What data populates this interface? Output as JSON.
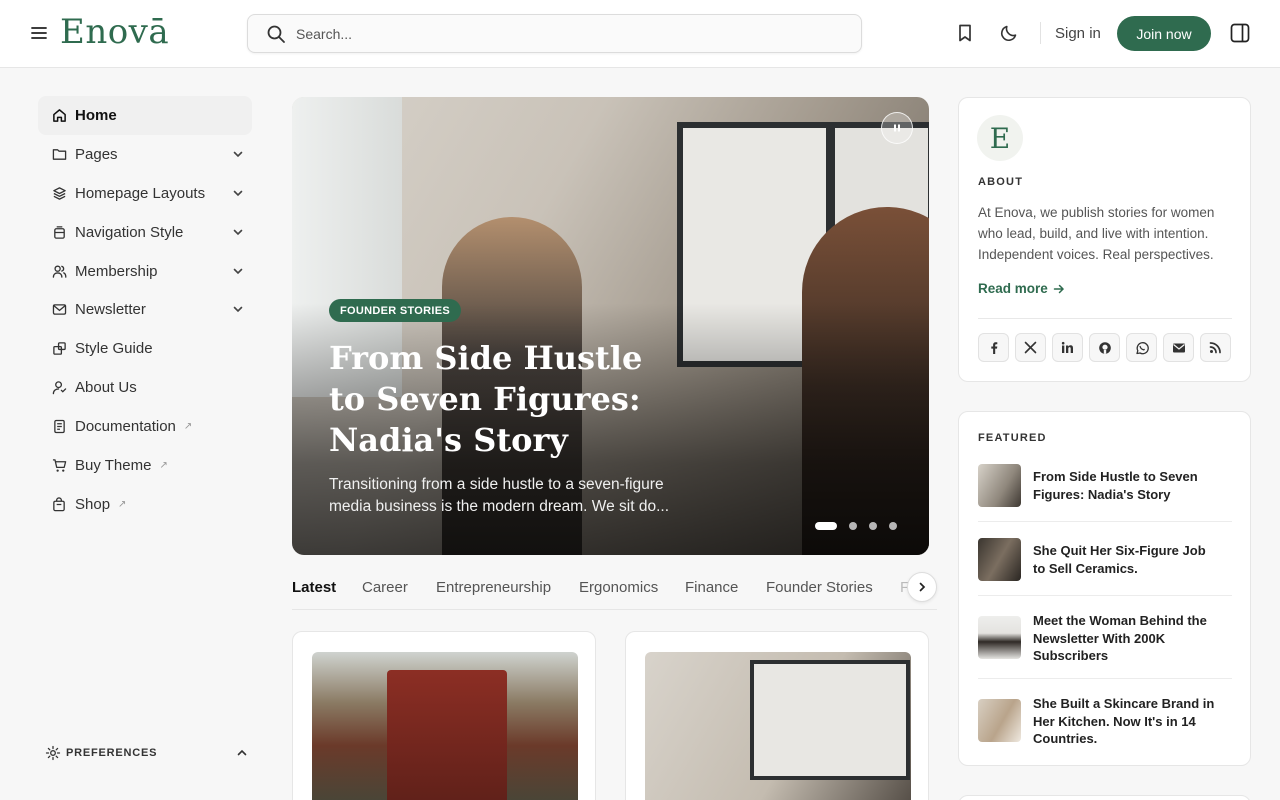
{
  "header": {
    "logo": "Enovā",
    "search_placeholder": "Search...",
    "sign_in": "Sign in",
    "join_now": "Join now",
    "accent": "#2f6b4f"
  },
  "sidebar": {
    "items": [
      {
        "label": "Home",
        "icon": "home-icon"
      },
      {
        "label": "Pages",
        "icon": "folder-icon"
      },
      {
        "label": "Homepage Layouts",
        "icon": "layers-icon"
      },
      {
        "label": "Navigation Style",
        "icon": "navigation-icon"
      },
      {
        "label": "Membership",
        "icon": "users-icon"
      },
      {
        "label": "Newsletter",
        "icon": "mail-icon"
      },
      {
        "label": "Style Guide",
        "icon": "style-icon"
      },
      {
        "label": "About Us",
        "icon": "user-icon"
      },
      {
        "label": "Documentation",
        "icon": "document-icon"
      },
      {
        "label": "Buy Theme",
        "icon": "cart-icon"
      },
      {
        "label": "Shop",
        "icon": "bag-icon"
      }
    ],
    "preferences": "PREFERENCES"
  },
  "hero": {
    "badge": "FOUNDER STORIES",
    "title": "From Side Hustle to Seven Figures: Nadia's Story",
    "excerpt": "Transitioning from a side hustle to a seven-figure media business is the modern dream. We sit do..."
  },
  "tabs": [
    "Latest",
    "Career",
    "Entrepreneurship",
    "Ergonomics",
    "Finance",
    "Founder Stories",
    "F"
  ],
  "about": {
    "emblem": "E",
    "label": "ABOUT",
    "text": "At Enova, we publish stories for women who lead, build, and live with intention. Independent voices. Real perspectives.",
    "read_more": "Read more"
  },
  "socials": [
    "facebook-icon",
    "x-icon",
    "linkedin-icon",
    "github-icon",
    "whatsapp-icon",
    "email-icon",
    "rss-icon"
  ],
  "featured": {
    "label": "FEATURED",
    "items": [
      "From Side Hustle to Seven Figures: Nadia's Story",
      "She Quit Her Six-Figure Job to Sell Ceramics.",
      "Meet the Woman Behind the Newsletter With 200K Subscribers",
      "She Built a Skincare Brand in Her Kitchen. Now It's in 14 Countries."
    ]
  }
}
